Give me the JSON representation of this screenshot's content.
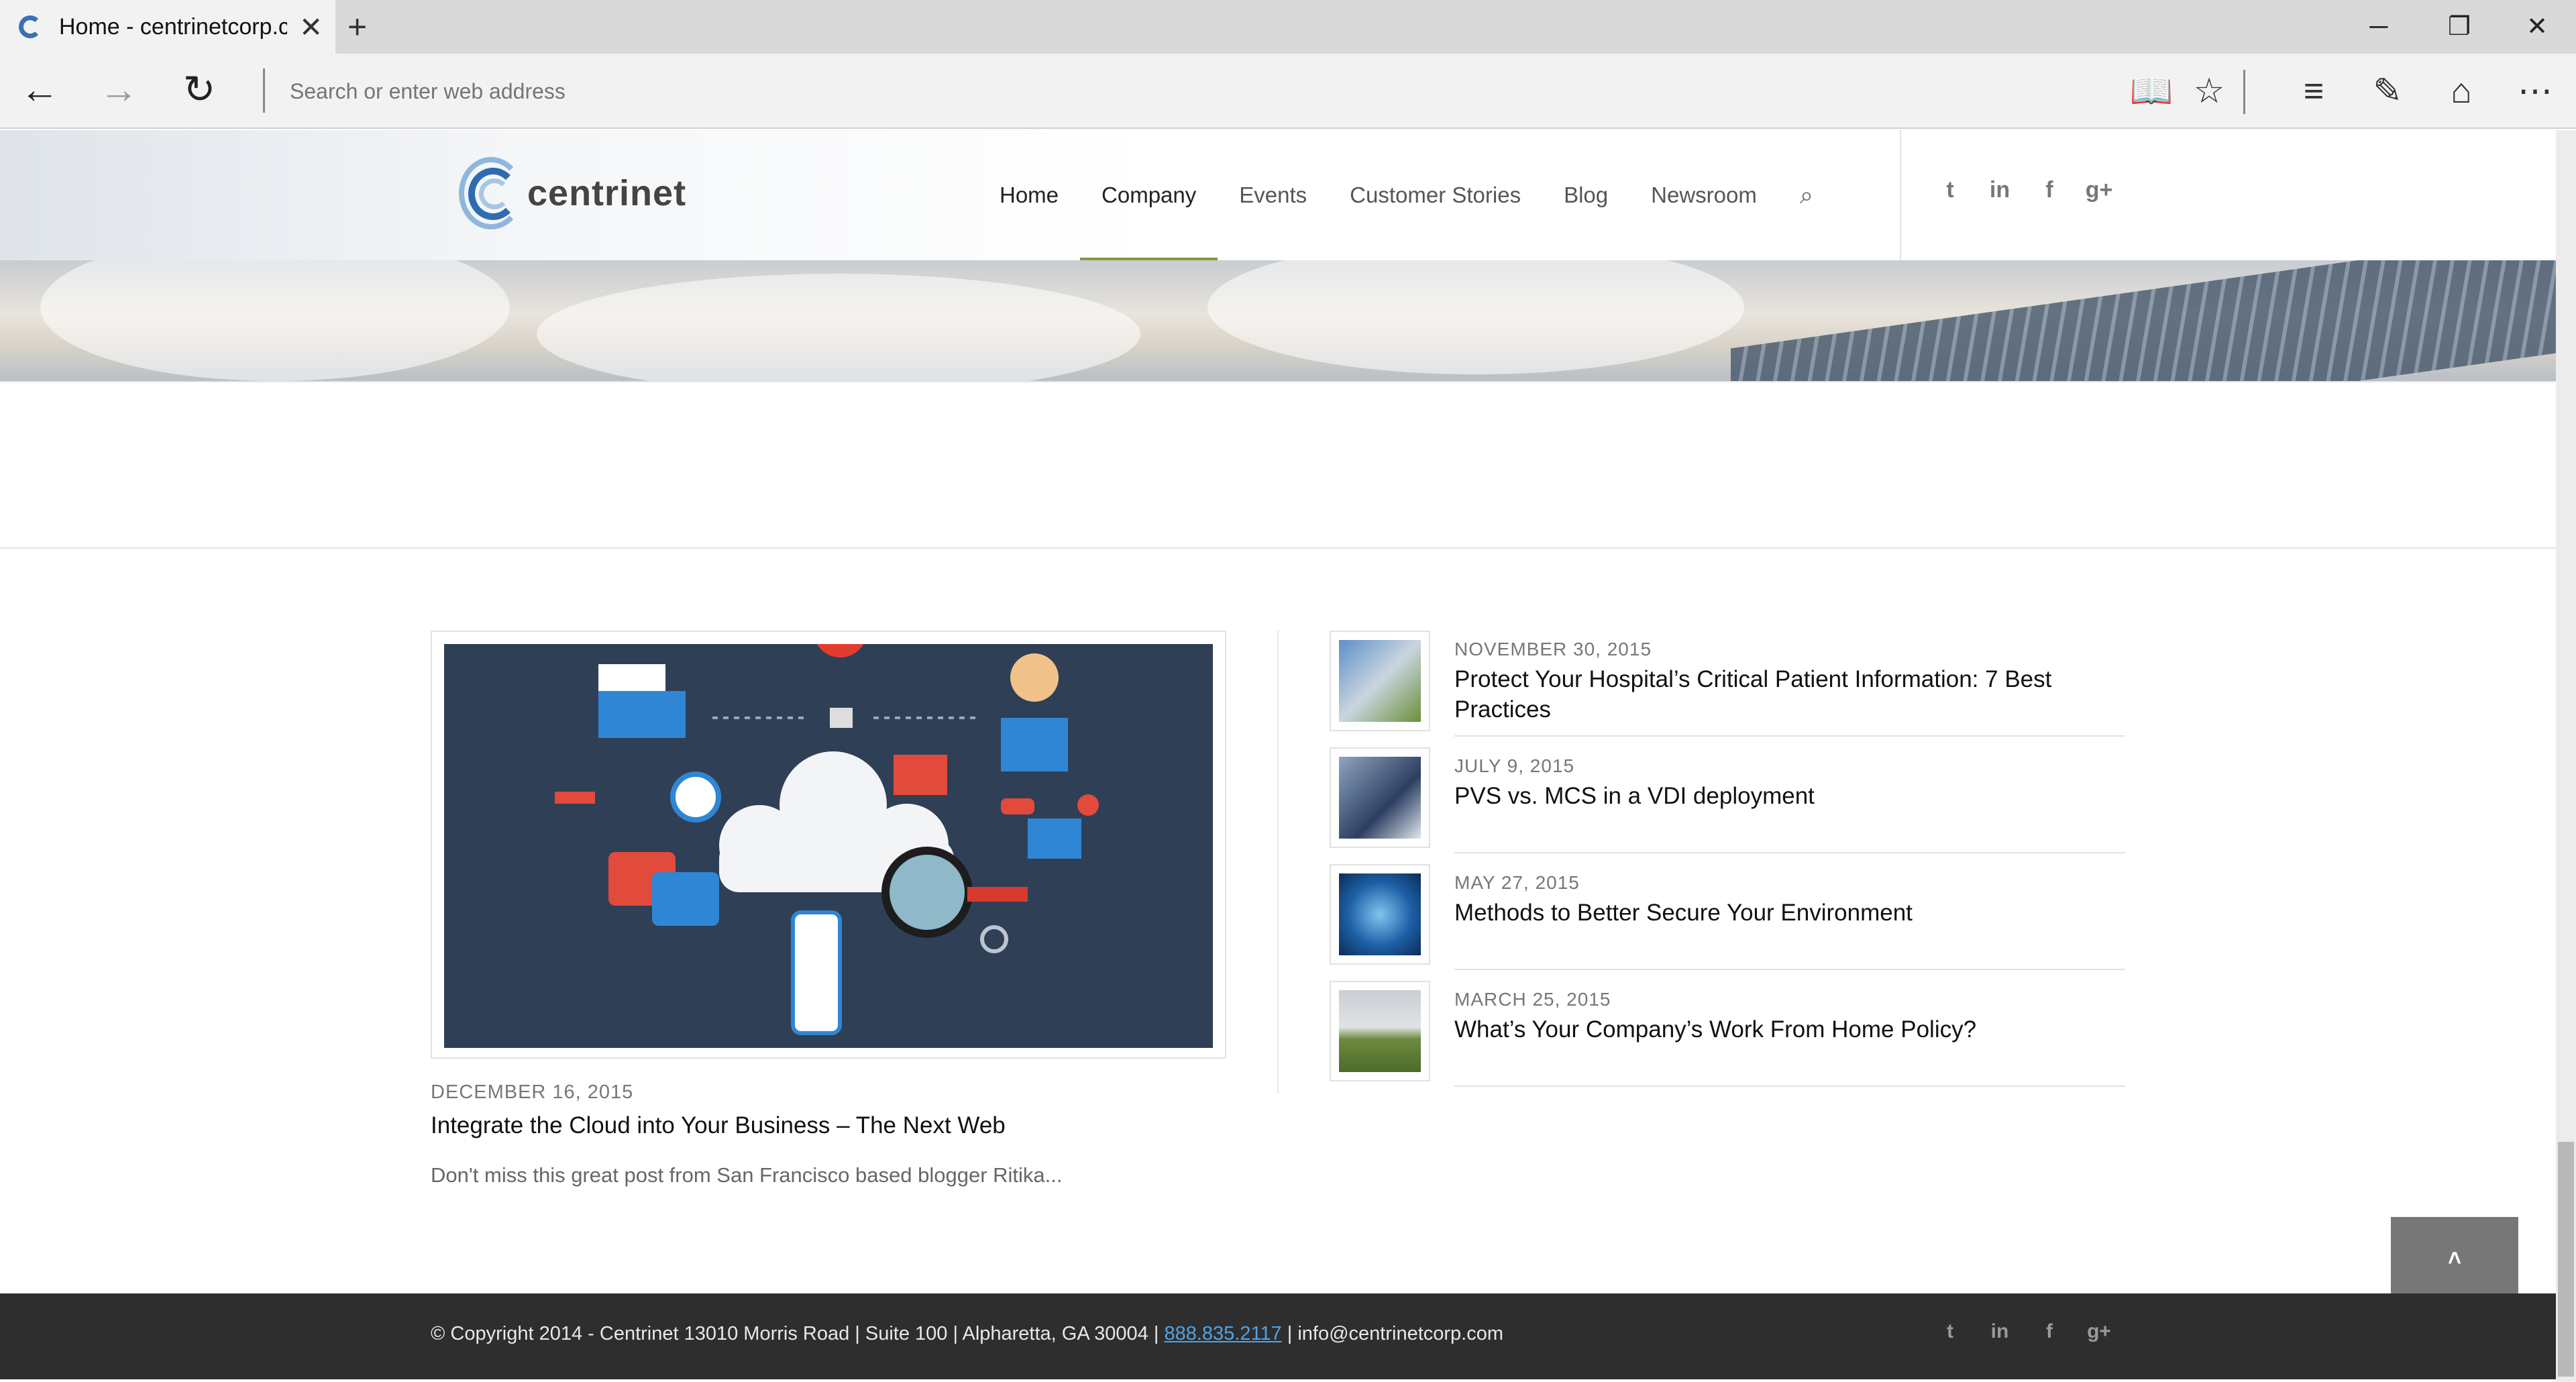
{
  "browser": {
    "tab_title": "Home - centrinetcorp.cc",
    "new_tab": "+",
    "address_placeholder": "Search or enter web address",
    "window_controls": {
      "minimize": "─",
      "restore": "❐",
      "close": "✕"
    }
  },
  "site": {
    "logo_text": "centrinet",
    "nav": [
      "Home",
      "Company",
      "Events",
      "Customer Stories",
      "Blog",
      "Newsroom"
    ],
    "social": [
      "twitter-icon",
      "linkedin-icon",
      "facebook-icon",
      "google-plus-icon"
    ]
  },
  "featured": {
    "date": "DECEMBER 16, 2015",
    "title": "Integrate the Cloud into Your Business – The Next Web",
    "excerpt": "Don't miss this great post from San Francisco based blogger Ritika..."
  },
  "posts": [
    {
      "date": "NOVEMBER 30, 2015",
      "title": "Protect Your Hospital’s Critical Patient Information: 7 Best Practices"
    },
    {
      "date": "JULY 9, 2015",
      "title": "PVS vs. MCS in a VDI deployment"
    },
    {
      "date": "MAY 27, 2015",
      "title": "Methods to Better Secure Your Environment"
    },
    {
      "date": "MARCH 25, 2015",
      "title": "What’s Your Company’s Work From Home Policy?"
    }
  ],
  "footer": {
    "copyright": "© Copyright 2014 - Centrinet 13010 Morris Road | Suite 100 | Alpharetta, GA 30004 | ",
    "phone": "888.835.2117",
    "email": " | info@centrinetcorp.com"
  },
  "scroll_top": "˄"
}
